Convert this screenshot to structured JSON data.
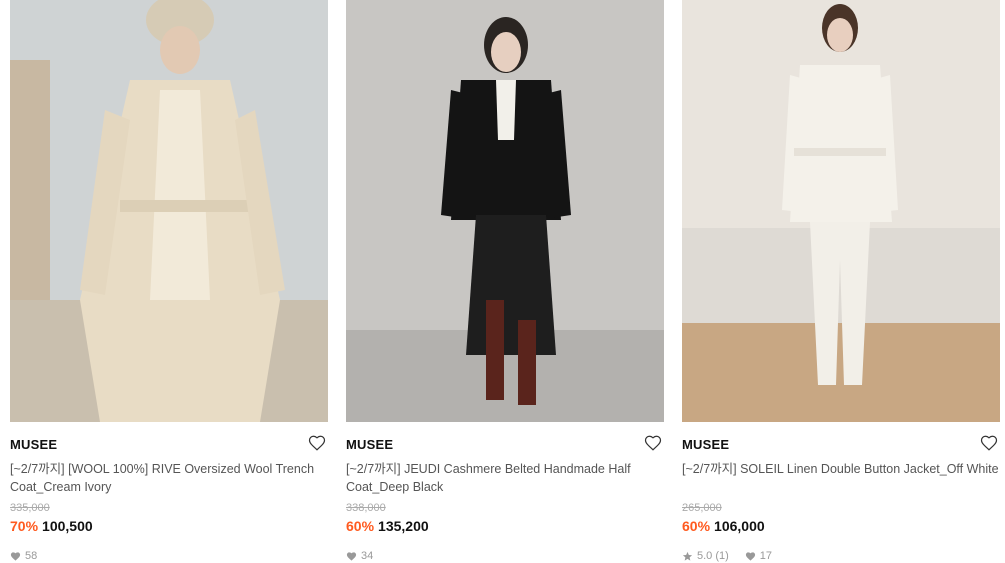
{
  "products": [
    {
      "brand": "MUSEE",
      "title": "[~2/7까지] [WOOL 100%] RIVE Oversized Wool Trench Coat_Cream Ivory",
      "original_price": "335,000",
      "discount": "70%",
      "price": "100,500",
      "rating": "",
      "likes": "58",
      "image": "model-cream-trench-coat"
    },
    {
      "brand": "MUSEE",
      "title": "[~2/7까지] JEUDI Cashmere Belted Handmade Half Coat_Deep Black",
      "original_price": "338,000",
      "discount": "60%",
      "price": "135,200",
      "rating": "",
      "likes": "34",
      "image": "model-black-half-coat"
    },
    {
      "brand": "MUSEE",
      "title": "[~2/7까지] SOLEIL Linen Double Button Jacket_Off White",
      "original_price": "265,000",
      "discount": "60%",
      "price": "106,000",
      "rating": "5.0 (1)",
      "likes": "17",
      "image": "model-white-linen-jacket"
    }
  ],
  "colors": {
    "discount": "#ff5a1f",
    "text": "#111111",
    "muted": "#999999"
  }
}
